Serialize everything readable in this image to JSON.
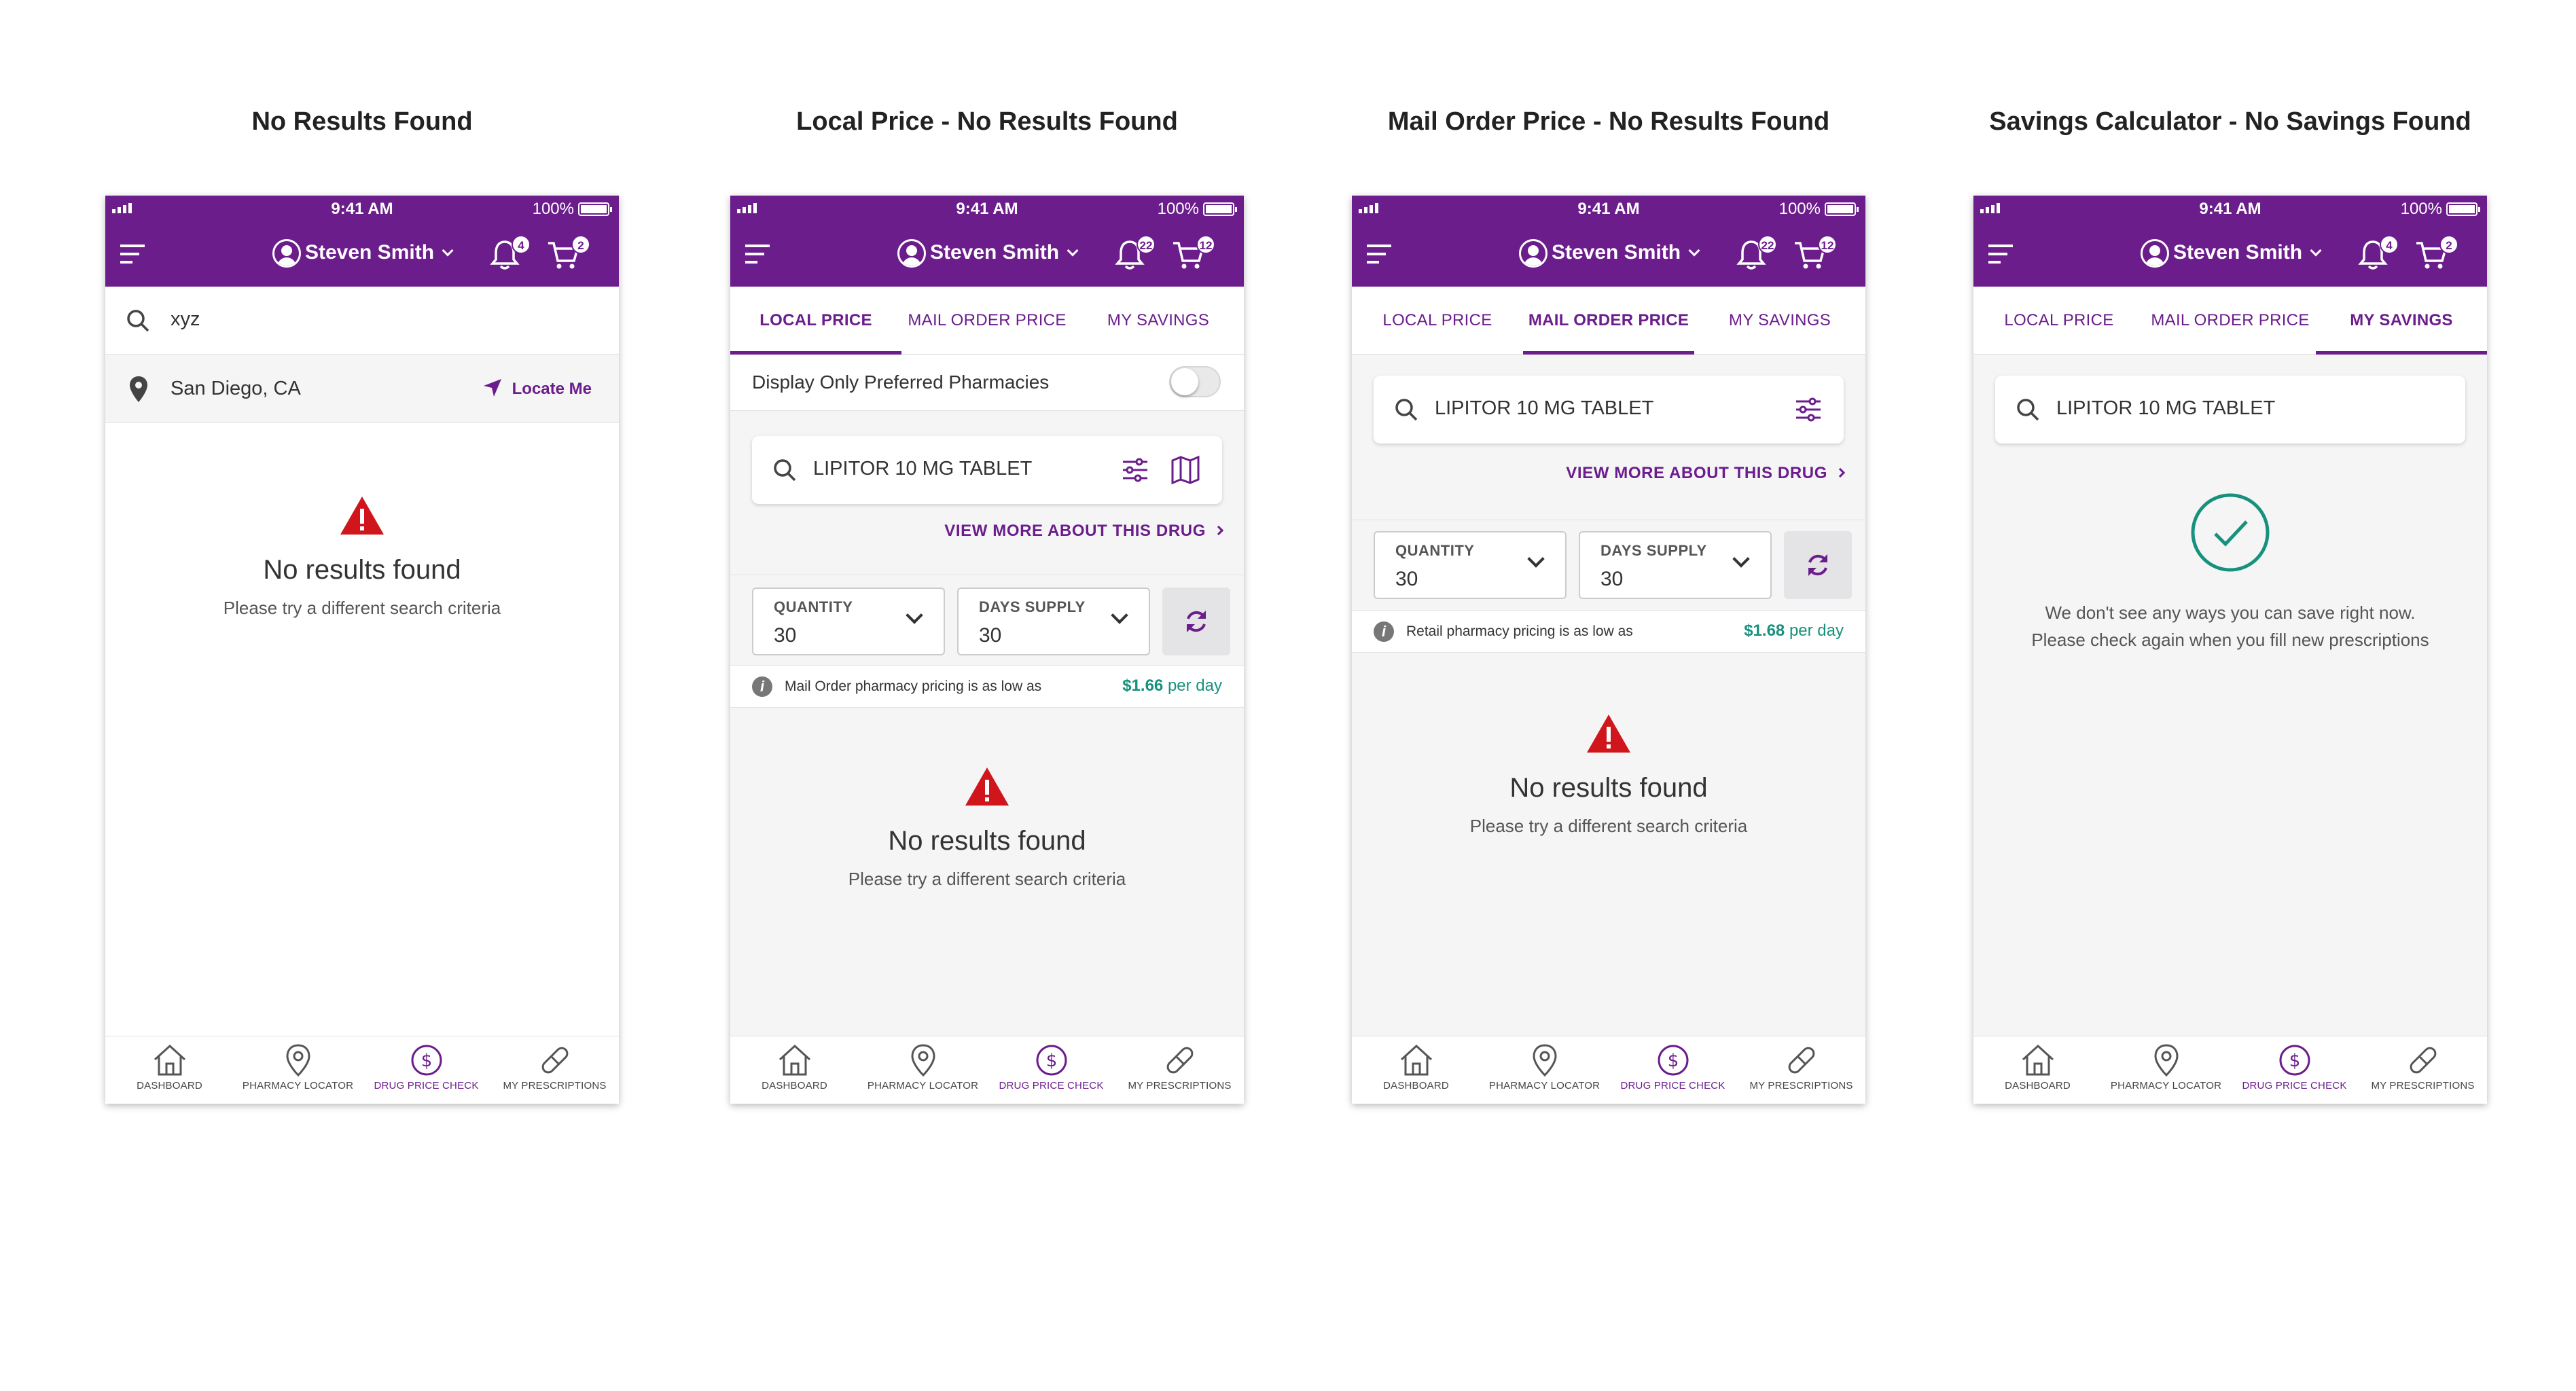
{
  "status_bar": {
    "time": "9:41 AM",
    "battery": "100%"
  },
  "header": {
    "user_name": "Steven Smith"
  },
  "tabs": {
    "local": "LOCAL PRICE",
    "mail": "MAIL ORDER PRICE",
    "savings": "MY SAVINGS"
  },
  "bottom_nav": {
    "dashboard": "DASHBOARD",
    "pharmacy": "PHARMACY LOCATOR",
    "drug": "DRUG PRICE CHECK",
    "prescriptions": "MY PRESCRIPTIONS"
  },
  "screens": [
    {
      "title": "No Results Found",
      "notif_count": "4",
      "cart_count": "2",
      "search_value": "xyz",
      "location": "San Diego, CA",
      "locate_label": "Locate Me",
      "message_title": "No results found",
      "message_sub": "Please try a different search criteria"
    },
    {
      "title": "Local Price - No Results Found",
      "notif_count": "22",
      "cart_count": "12",
      "toggle_label": "Display Only Preferred Pharmacies",
      "drug": "LIPITOR 10 MG TABLET",
      "view_more": "VIEW MORE ABOUT THIS DRUG",
      "quantity_label": "QUANTITY",
      "quantity": "30",
      "days_label": "DAYS SUPPLY",
      "days": "30",
      "note": "Mail Order pharmacy pricing is as low as",
      "price": "$1.66",
      "per_day": "per day",
      "message_title": "No results found",
      "message_sub": "Please try a different search criteria"
    },
    {
      "title": "Mail Order Price - No Results Found",
      "notif_count": "22",
      "cart_count": "12",
      "drug": "LIPITOR 10 MG TABLET",
      "view_more": "VIEW MORE ABOUT THIS DRUG",
      "quantity_label": "QUANTITY",
      "quantity": "30",
      "days_label": "DAYS SUPPLY",
      "days": "30",
      "note": "Retail pharmacy pricing is as low as",
      "price": "$1.68",
      "per_day": "per day",
      "message_title": "No results found",
      "message_sub": "Please try a different search criteria"
    },
    {
      "title": "Savings Calculator - No Savings Found",
      "notif_count": "4",
      "cart_count": "2",
      "drug": "LIPITOR 10 MG TABLET",
      "message_line1": "We don't see any ways you can save right now.",
      "message_line2": "Please check again when you fill new prescriptions"
    }
  ],
  "colors": {
    "brand": "#6b1d8c",
    "accent_green": "#17917d",
    "warning": "#d0161c",
    "background": "#f5f5f6"
  }
}
